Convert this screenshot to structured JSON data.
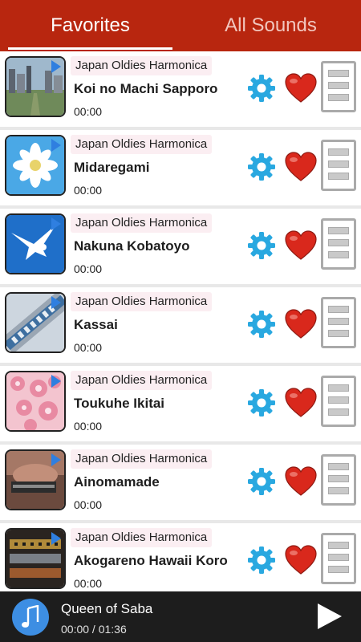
{
  "tabs": [
    {
      "label": "Favorites",
      "active": true
    },
    {
      "label": "All Sounds",
      "active": false
    }
  ],
  "colors": {
    "accent": "#b8260f",
    "player_bg": "#1d1d1d",
    "gear": "#29a8e0",
    "heart": "#d9281c"
  },
  "songs": [
    {
      "category": "Japan Oldies Harmonica",
      "title": "Koi no Machi Sapporo",
      "time": "00:00",
      "thumb": "city-skyline",
      "favorite": true
    },
    {
      "category": "Japan Oldies Harmonica",
      "title": "Midaregami",
      "time": "00:00",
      "thumb": "white-flower",
      "favorite": true
    },
    {
      "category": "Japan Oldies Harmonica",
      "title": "Nakuna Kobatoyo",
      "time": "00:00",
      "thumb": "white-dove",
      "favorite": true
    },
    {
      "category": "Japan Oldies Harmonica",
      "title": "Kassai",
      "time": "00:00",
      "thumb": "harmonica-closeup",
      "favorite": true
    },
    {
      "category": "Japan Oldies Harmonica",
      "title": "Toukuhe Ikitai",
      "time": "00:00",
      "thumb": "cherry-blossoms",
      "favorite": true
    },
    {
      "category": "Japan Oldies Harmonica",
      "title": "Ainomamade",
      "time": "00:00",
      "thumb": "harmonica-player",
      "favorite": true
    },
    {
      "category": "Japan Oldies Harmonica",
      "title": "Akogareno Hawaii Koro",
      "time": "00:00",
      "thumb": "harmonicas",
      "favorite": true
    }
  ],
  "player": {
    "title": "Queen of Saba",
    "time": "00:00 / 01:36",
    "icon": "music-note-icon",
    "button": "play-icon"
  }
}
